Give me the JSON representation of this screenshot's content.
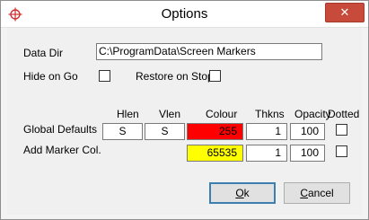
{
  "window": {
    "title": "Options",
    "close_glyph": "✕"
  },
  "form": {
    "data_dir_label": "Data Dir",
    "data_dir_value": "C:\\ProgramData\\Screen Markers",
    "hide_on_go_label": "Hide on Go",
    "restore_on_stop_label": "Restore on Stop"
  },
  "table": {
    "headers": {
      "hlen": "Hlen",
      "vlen": "Vlen",
      "colour": "Colour",
      "thkns": "Thkns",
      "opacity": "Opacity",
      "dotted": "Dotted"
    },
    "rows": [
      {
        "label": "Global Defaults",
        "hlen": "S",
        "vlen": "S",
        "colour": "255",
        "colour_bg": "#ff0000",
        "thkns": "1",
        "opacity": "100"
      },
      {
        "label": "Add Marker Col.",
        "hlen": "",
        "vlen": "",
        "colour": "65535",
        "colour_bg": "#ffff00",
        "thkns": "1",
        "opacity": "100"
      }
    ]
  },
  "buttons": {
    "ok_prefix": "O",
    "ok_rest": "k",
    "cancel_prefix": "C",
    "cancel_rest": "ancel"
  },
  "icons": {
    "app": "crosshair-icon",
    "close": "close-icon"
  },
  "colors": {
    "close_button": "#c74a3b",
    "default_button_border": "#3c7fb1"
  }
}
